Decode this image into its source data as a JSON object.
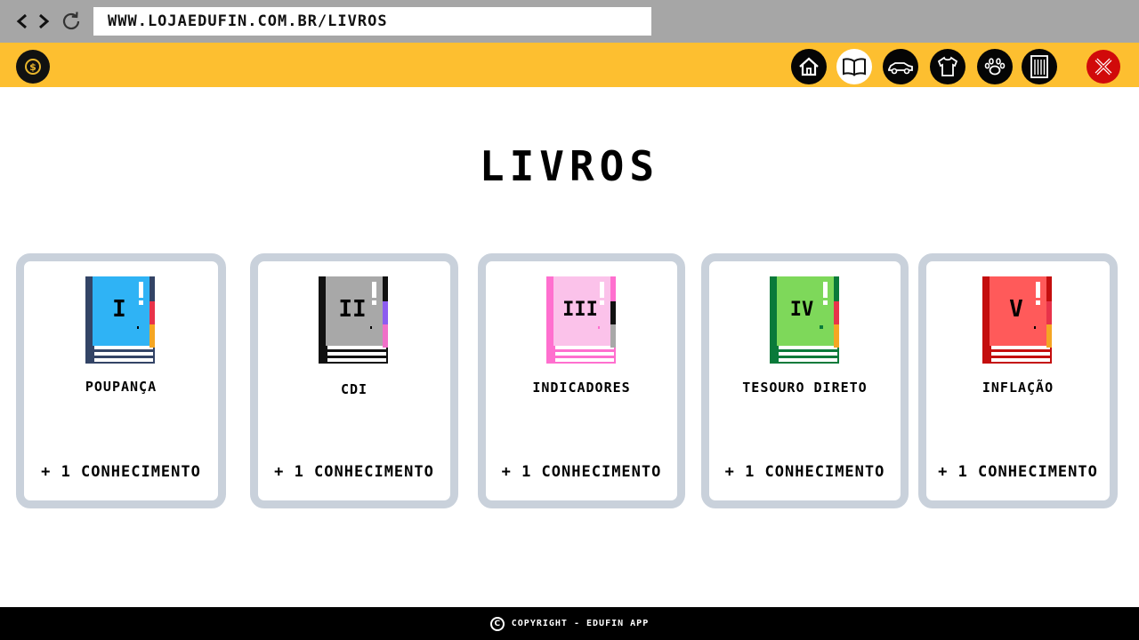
{
  "browser": {
    "url": "WWW.LOJAEDUFIN.COM.BR/LIVROS",
    "back_icon": "chevron-left-icon",
    "forward_icon": "chevron-right-icon",
    "reload_icon": "reload-icon"
  },
  "header": {
    "accent_color": "#fdbf30",
    "logo_glyph": "$",
    "nav_items": [
      {
        "name": "home",
        "icon": "home-icon"
      },
      {
        "name": "books",
        "icon": "book-icon",
        "active": true
      },
      {
        "name": "car",
        "icon": "car-icon"
      },
      {
        "name": "clothes",
        "icon": "shirt-icon"
      },
      {
        "name": "pets",
        "icon": "paw-icon"
      },
      {
        "name": "buildings",
        "icon": "building-icon"
      }
    ],
    "close_icon": "close-icon",
    "close_color": "#d10a0a"
  },
  "page": {
    "title": "LIVROS"
  },
  "cards": [
    {
      "numeral": "I",
      "name": "POUPANÇA",
      "reward": "+ 1 CONHECIMENTO",
      "cover_color": "#2fb3f5",
      "spine_color": "#334466"
    },
    {
      "numeral": "II",
      "name": "CDI",
      "reward": "+ 1 CONHECIMENTO",
      "cover_color": "#a8a8a8",
      "spine_color": "#111111"
    },
    {
      "numeral": "III",
      "name": "INDICADORES",
      "reward": "+ 1 CONHECIMENTO",
      "cover_color": "#fbc2ea",
      "spine_color": "#ff6fcf"
    },
    {
      "numeral": "IV",
      "name": "TESOURO DIRETO",
      "reward": "+ 1 CONHECIMENTO",
      "cover_color": "#7ed85a",
      "spine_color": "#0a7a3a"
    },
    {
      "numeral": "V",
      "name": "INFLAÇÃO",
      "reward": "+ 1 CONHECIMENTO",
      "cover_color": "#ff5a5a",
      "spine_color": "#c40e0e"
    }
  ],
  "footer": {
    "copyright_glyph": "C",
    "text": "COPYRIGHT - EDUFIN APP"
  }
}
